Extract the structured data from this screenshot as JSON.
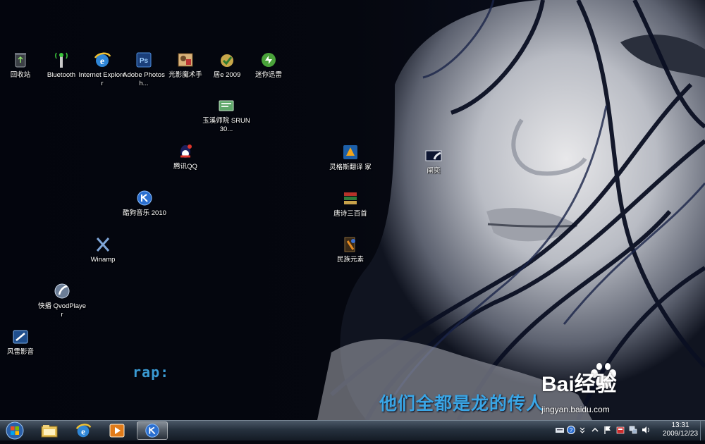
{
  "desktop": {
    "icons": [
      {
        "label": "回收站",
        "icon": "recycle-bin-icon"
      },
      {
        "label": "Bluetooth",
        "icon": "bluetooth-icon"
      },
      {
        "label": "Internet Explorer",
        "icon": "internet-explorer-icon"
      },
      {
        "label": "Adobe Photosh...",
        "icon": "photoshop-icon"
      },
      {
        "label": "光影魔术手",
        "icon": "nevercenter-photo-icon"
      },
      {
        "label": "居e 2009",
        "icon": "jue-2009-icon"
      },
      {
        "label": "迷你迅雷",
        "icon": "mini-thunder-icon"
      },
      {
        "label": "玉溪师院 SRUN30...",
        "icon": "srun-client-icon"
      },
      {
        "label": "腾讯QQ",
        "icon": "qq-icon"
      },
      {
        "label": "酷狗音乐 2010",
        "icon": "kugou-music-icon"
      },
      {
        "label": "Winamp",
        "icon": "winamp-icon"
      },
      {
        "label": "快播 QvodPlayer",
        "icon": "qvod-player-icon"
      },
      {
        "label": "风雷影音",
        "icon": "fenglei-player-icon"
      },
      {
        "label": "灵格斯翻译 家",
        "icon": "lingoes-icon"
      },
      {
        "label": "唐诗三百首",
        "icon": "tang-poems-book-icon"
      },
      {
        "label": "民族元素",
        "icon": "ethnic-elements-icon"
      },
      {
        "label": "阐奕",
        "icon": "image-file-icon"
      }
    ]
  },
  "lyrics": {
    "rap": "rap:",
    "line": "他们全都是龙的传人"
  },
  "watermark": {
    "brand": "Bai经验",
    "url": "jingyan.baidu.com"
  },
  "taskbar": {
    "pinned": [
      {
        "icon": "windows-explorer-icon"
      },
      {
        "icon": "internet-explorer-icon"
      },
      {
        "icon": "media-player-icon"
      },
      {
        "icon": "kugou-music-icon",
        "active": true
      }
    ],
    "tray_icons": [
      "keyboard-icon",
      "help-icon",
      "chevron-icon",
      "show-hidden-icons-icon",
      "action-center-flag-icon",
      "security-icon",
      "network-icon",
      "volume-icon"
    ],
    "clock": {
      "time": "13:31",
      "date": "2009/12/23"
    }
  },
  "colors": {
    "lyric": "#3aa6e6",
    "taskbar": "#1e2733",
    "wallpaper_dark": "#05070f"
  }
}
